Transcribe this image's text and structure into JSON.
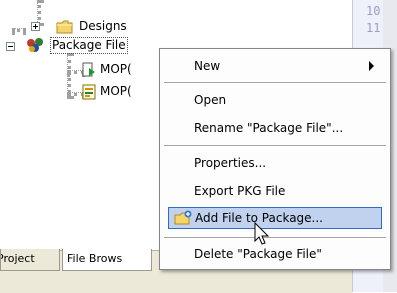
{
  "tree": {
    "items": [
      {
        "label": "Designs"
      },
      {
        "label": "Package File"
      },
      {
        "label": "MOP("
      },
      {
        "label": "MOP("
      }
    ]
  },
  "editor": {
    "line_numbers": [
      "10",
      "11"
    ]
  },
  "tabs": [
    {
      "label": "Project"
    },
    {
      "label": "File Brows"
    }
  ],
  "context_menu": {
    "items": [
      {
        "label": "New",
        "submenu": true
      },
      {
        "label": "Open"
      },
      {
        "label": "Rename \"Package File\"..."
      },
      {
        "label": "Properties..."
      },
      {
        "label": "Export PKG File"
      },
      {
        "label": "Add File to Package...",
        "highlighted": true
      },
      {
        "label": "Delete \"Package File\""
      }
    ]
  },
  "colors": {
    "menu_highlight": "#c1d2ee",
    "menu_highlight_border": "#316ac5",
    "folder": "#f3d56b",
    "editor_bg": "#eef0fa"
  }
}
